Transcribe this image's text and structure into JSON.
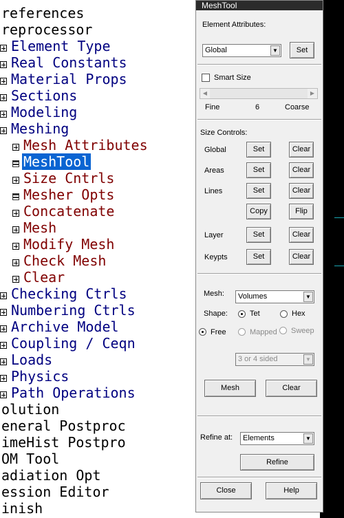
{
  "tree": {
    "items": [
      {
        "text": "references",
        "level": 0,
        "icon": "none"
      },
      {
        "text": "reprocessor",
        "level": 0,
        "icon": "none"
      },
      {
        "text": "Element Type",
        "level": 1,
        "icon": "expand"
      },
      {
        "text": "Real Constants",
        "level": 1,
        "icon": "expand"
      },
      {
        "text": "Material Props",
        "level": 1,
        "icon": "expand"
      },
      {
        "text": "Sections",
        "level": 1,
        "icon": "expand"
      },
      {
        "text": "Modeling",
        "level": 1,
        "icon": "expand"
      },
      {
        "text": "Meshing",
        "level": 1,
        "icon": "expand"
      },
      {
        "text": "Mesh Attributes",
        "level": 2,
        "icon": "expand"
      },
      {
        "text": "MeshTool",
        "level": 2,
        "icon": "tool",
        "selected": true
      },
      {
        "text": "Size Cntrls",
        "level": 2,
        "icon": "expand"
      },
      {
        "text": "Mesher Opts",
        "level": 2,
        "icon": "tool"
      },
      {
        "text": "Concatenate",
        "level": 2,
        "icon": "expand"
      },
      {
        "text": "Mesh",
        "level": 2,
        "icon": "expand"
      },
      {
        "text": "Modify Mesh",
        "level": 2,
        "icon": "expand"
      },
      {
        "text": "Check Mesh",
        "level": 2,
        "icon": "expand"
      },
      {
        "text": "Clear",
        "level": 2,
        "icon": "expand"
      },
      {
        "text": "Checking Ctrls",
        "level": 1,
        "icon": "expand"
      },
      {
        "text": "Numbering Ctrls",
        "level": 1,
        "icon": "expand"
      },
      {
        "text": "Archive Model",
        "level": 1,
        "icon": "expand"
      },
      {
        "text": "Coupling / Ceqn",
        "level": 1,
        "icon": "expand"
      },
      {
        "text": "Loads",
        "level": 1,
        "icon": "expand"
      },
      {
        "text": "Physics",
        "level": 1,
        "icon": "expand"
      },
      {
        "text": "Path Operations",
        "level": 1,
        "icon": "expand"
      },
      {
        "text": "olution",
        "level": 0,
        "icon": "none"
      },
      {
        "text": "eneral Postproc",
        "level": 0,
        "icon": "none"
      },
      {
        "text": "imeHist Postpro",
        "level": 0,
        "icon": "none"
      },
      {
        "text": "OM Tool",
        "level": 0,
        "icon": "none"
      },
      {
        "text": "adiation Opt",
        "level": 0,
        "icon": "none"
      },
      {
        "text": "ession Editor",
        "level": 0,
        "icon": "none"
      },
      {
        "text": "inish",
        "level": 0,
        "icon": "none"
      }
    ]
  },
  "meshtool": {
    "title": "MeshTool",
    "element_attributes": {
      "label": "Element Attributes:",
      "select_value": "Global",
      "set_label": "Set"
    },
    "smart_size": {
      "label": "Smart Size",
      "checked": false,
      "fine_label": "Fine",
      "value": "6",
      "coarse_label": "Coarse"
    },
    "size_controls": {
      "label": "Size Controls:",
      "rows": [
        {
          "label": "Global",
          "set": "Set",
          "clear": "Clear"
        },
        {
          "label": "Areas",
          "set": "Set",
          "clear": "Clear"
        },
        {
          "label": "Lines",
          "set": "Set",
          "clear": "Clear"
        },
        {
          "label": "",
          "set": "Copy",
          "clear": "Flip"
        },
        {
          "label": "Layer",
          "set": "Set",
          "clear": "Clear"
        },
        {
          "label": "Keypts",
          "set": "Set",
          "clear": "Clear"
        }
      ]
    },
    "mesh": {
      "label": "Mesh:",
      "select_value": "Volumes",
      "shape_label": "Shape:",
      "tet_label": "Tet",
      "hex_label": "Hex",
      "free_label": "Free",
      "mapped_label": "Mapped",
      "sweep_label": "Sweep",
      "sided_value": "3 or 4 sided",
      "mesh_button": "Mesh",
      "clear_button": "Clear"
    },
    "refine": {
      "label": "Refine at:",
      "select_value": "Elements",
      "button": "Refine"
    },
    "footer": {
      "close": "Close",
      "help": "Help"
    }
  },
  "colors": {
    "selection": "#0a64d2",
    "level1": "#000080",
    "level2": "#800000",
    "titlebar": "#2b2b2b"
  }
}
